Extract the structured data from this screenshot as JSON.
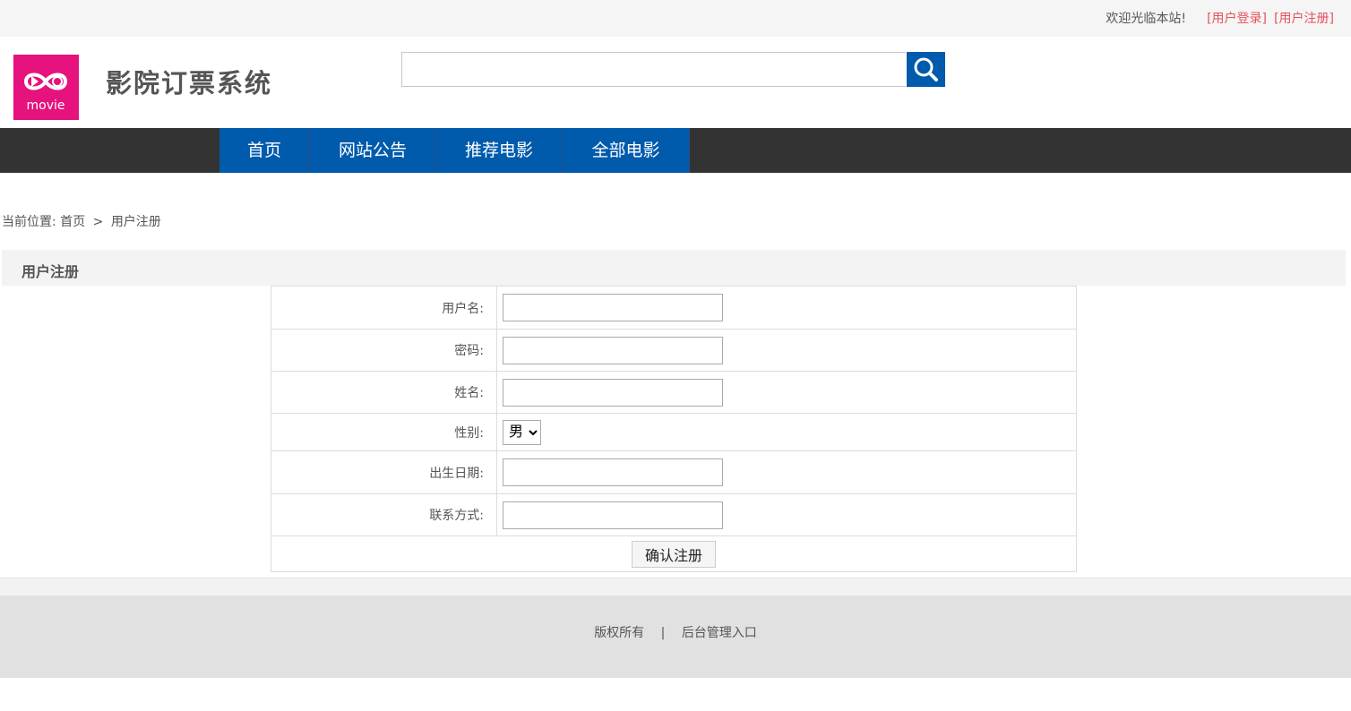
{
  "topbar": {
    "welcome": "欢迎光临本站!",
    "login_link": "[用户登录]",
    "register_link": "[用户注册]"
  },
  "header": {
    "logo_text": "movie",
    "site_title": "影院订票系统",
    "search_placeholder": ""
  },
  "nav": {
    "items": [
      {
        "label": "首页"
      },
      {
        "label": "网站公告"
      },
      {
        "label": "推荐电影"
      },
      {
        "label": "全部电影"
      }
    ]
  },
  "breadcrumb": {
    "prefix": "当前位置:",
    "home": "首页",
    "separator": ">",
    "current": "用户注册"
  },
  "section": {
    "title": "用户注册"
  },
  "form": {
    "username_label": "用户名:",
    "password_label": "密码:",
    "name_label": "姓名:",
    "gender_label": "性别:",
    "gender_value": "男",
    "birthday_label": "出生日期:",
    "contact_label": "联系方式:",
    "submit_label": "确认注册"
  },
  "footer": {
    "copyright": "版权所有",
    "separator": "|",
    "admin_link": "后台管理入口"
  },
  "colors": {
    "nav_blue": "#005bac",
    "logo_pink": "#e6127e",
    "link_red": "#e8505b",
    "nav_bar": "#333333"
  }
}
